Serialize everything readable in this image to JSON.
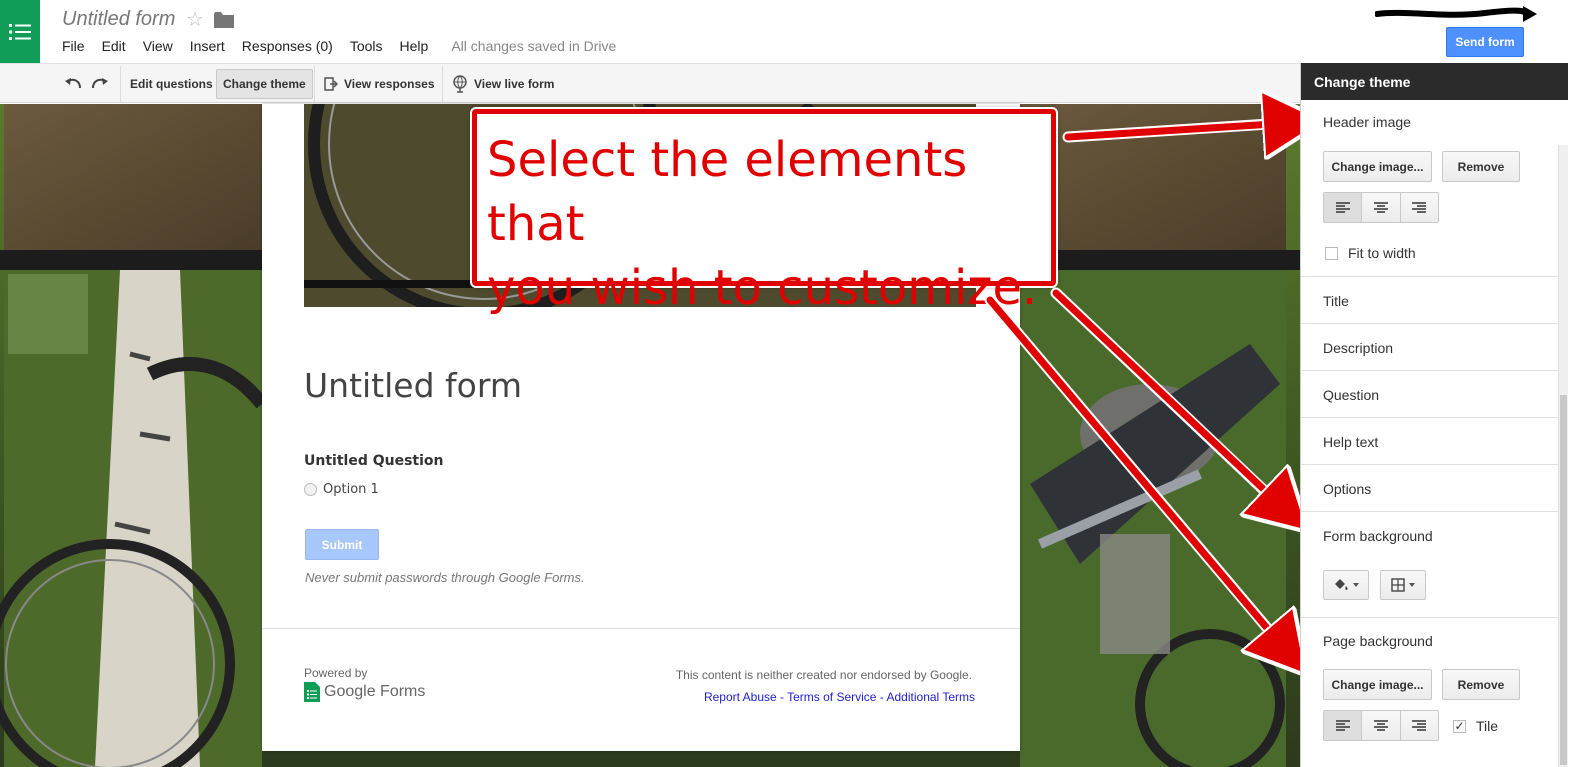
{
  "app": {
    "doc_title": "Untitled form",
    "save_status": "All changes saved in Drive",
    "send_label": "Send form"
  },
  "menu": [
    "File",
    "Edit",
    "View",
    "Insert",
    "Responses (0)",
    "Tools",
    "Help"
  ],
  "toolbar": {
    "edit_questions": "Edit questions",
    "change_theme": "Change theme",
    "view_responses": "View responses",
    "view_live_form": "View live form"
  },
  "form": {
    "title": "Untitled form",
    "question_title": "Untitled Question",
    "option_label": "Option 1",
    "submit_label": "Submit",
    "password_warning": "Never submit passwords through Google Forms.",
    "powered_by": "Powered by",
    "logo_text": "Google Forms",
    "endorsement": "This content is neither created nor endorsed by Google.",
    "links": {
      "report": "Report Abuse",
      "terms": "Terms of Service",
      "additional": "Additional Terms",
      "sep": " - "
    }
  },
  "annotation": {
    "line1": "Select the elements that",
    "line2": "you wish to customize."
  },
  "panel": {
    "title": "Change theme",
    "header_image": "Header image",
    "change_image": "Change image...",
    "remove": "Remove",
    "fit_to_width": "Fit to width",
    "title_label": "Title",
    "description": "Description",
    "question": "Question",
    "help_text": "Help text",
    "options": "Options",
    "form_background": "Form background",
    "page_background": "Page background",
    "change_image_2": "Change image...",
    "remove_2": "Remove",
    "tile": "Tile"
  },
  "colors": {
    "brand_green": "#0f9d58",
    "send_blue": "#4d90fe",
    "annotation_red": "#e00000",
    "panel_header": "#2b2b2b"
  }
}
